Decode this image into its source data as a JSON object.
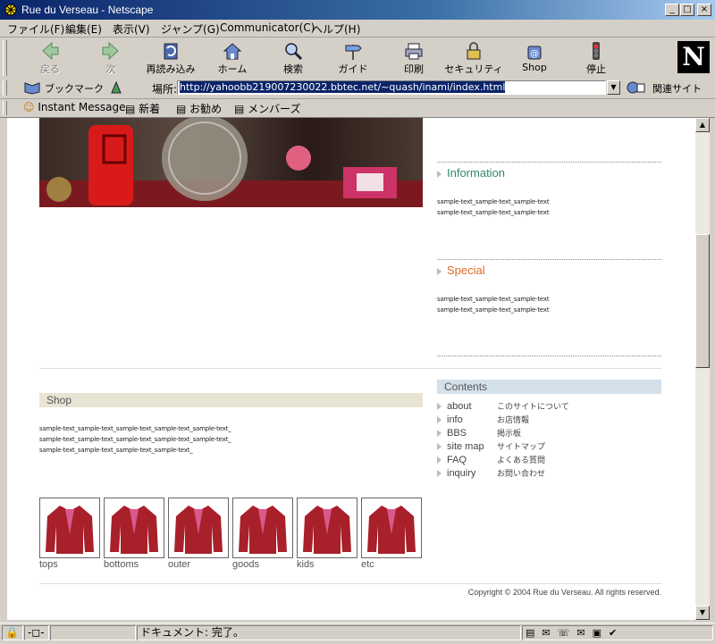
{
  "window": {
    "title": "Rue du Verseau - Netscape"
  },
  "menu": [
    "ファイル(F)",
    "編集(E)",
    "表示(V)",
    "ジャンプ(G)",
    "Communicator(C)",
    "ヘルプ(H)"
  ],
  "toolbar": {
    "back": "戻る",
    "forward": "次",
    "reload": "再読み込み",
    "home": "ホーム",
    "search": "検索",
    "guide": "ガイド",
    "print": "印刷",
    "security": "セキュリティ",
    "shop": "Shop",
    "stop": "停止"
  },
  "location": {
    "bookmarks": "ブックマーク",
    "label": "場所:",
    "url": "http://yahoobb219007230022.bbtec.net/~quash/inami/index.html",
    "related": "関連サイト"
  },
  "personal": {
    "instant": "Instant Message",
    "new": "新着",
    "recommend": "お勧め",
    "members": "メンバーズ"
  },
  "page": {
    "information_title": "Information",
    "information_lines": [
      "sample-text_sample-text_sample-text",
      "sample-text_sample-text_sample-text"
    ],
    "special_title": "Special",
    "special_lines": [
      "sample-text_sample-text_sample-text",
      "sample-text_sample-text_sample-text"
    ],
    "shop_title": "Shop",
    "shop_lines": [
      "sample-text_sample-text_sample-text_sample-text_sample-text_",
      "sample-text_sample-text_sample-text_sample-text_sample-text_",
      "sample-text_sample-text_sample-text_sample-text_"
    ],
    "contents_title": "Contents",
    "contents": [
      {
        "key": "about",
        "label": "このサイトについて"
      },
      {
        "key": "info",
        "label": "お店情報"
      },
      {
        "key": "BBS",
        "label": "掲示板"
      },
      {
        "key": "site map",
        "label": "サイトマップ"
      },
      {
        "key": "FAQ",
        "label": "よくある質問"
      },
      {
        "key": "inquiry",
        "label": "お問い合わせ"
      }
    ],
    "products": [
      "tops",
      "bottoms",
      "outer",
      "goods",
      "kids",
      "etc"
    ],
    "copyright": "Copyright © 2004 Rue du Verseau. All rights reserved.",
    "colors": {
      "information": "#2e8a6a",
      "special": "#e06a2a",
      "shop_bar": "#e8e4d4",
      "contents_bar": "#d4e0ea"
    }
  },
  "status": {
    "text": "ドキュメント: 完了。"
  }
}
